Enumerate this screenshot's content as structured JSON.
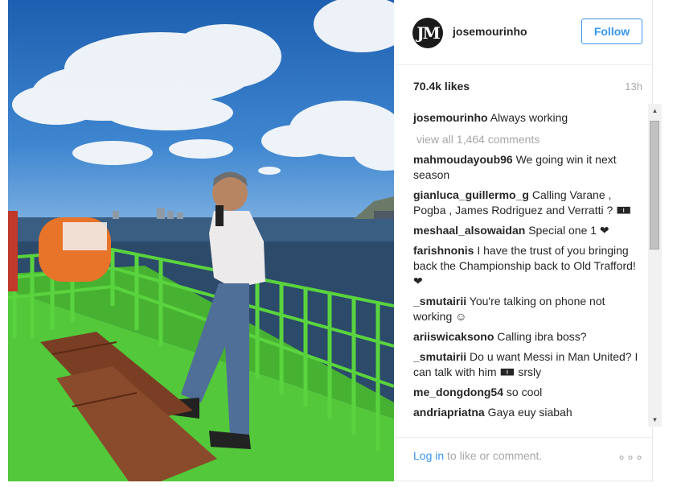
{
  "post": {
    "username": "josemourinho",
    "avatar_icon": "jm-monogram-icon",
    "avatar_text": "JM",
    "follow_label": "Follow",
    "likes": "70.4k likes",
    "time": "13h",
    "caption": {
      "user": "josemourinho",
      "text": "Always working"
    },
    "view_all": "view all 1,464 comments",
    "comments": [
      {
        "user": "mahmoudayoub96",
        "text": "We going win it next season"
      },
      {
        "user": "gianluca_guillermo_g",
        "text": "Calling Varane , Pogba , James Rodriguez and Verratti ? 🀰"
      },
      {
        "user": "meshaal_alsowaidan",
        "text": "Special one 1 ❤"
      },
      {
        "user": "farishnonis",
        "text": "I have the trust of you bringing back the Championship back to Old Trafford! ❤"
      },
      {
        "user": "_smutairii",
        "text": "You're talking on phone not working ☺"
      },
      {
        "user": "ariiswicaksono",
        "text": "Calling ibra boss?"
      },
      {
        "user": "_smutairii",
        "text": "Do u want Messi in Man United? I can talk with him 🀰 srsly"
      },
      {
        "user": "me_dongdong54",
        "text": "so cool"
      },
      {
        "user": "andriapriatna",
        "text": "Gaya euy siabah"
      }
    ],
    "login_link": "Log in",
    "login_text": "to like or comment.",
    "more_icon": "ellipsis-icon",
    "more_text": "∘∘∘"
  },
  "colors": {
    "accent": "#3897f0",
    "muted": "#a5a7aa",
    "railing": "#55d13a",
    "bench": "#7a3e24"
  }
}
